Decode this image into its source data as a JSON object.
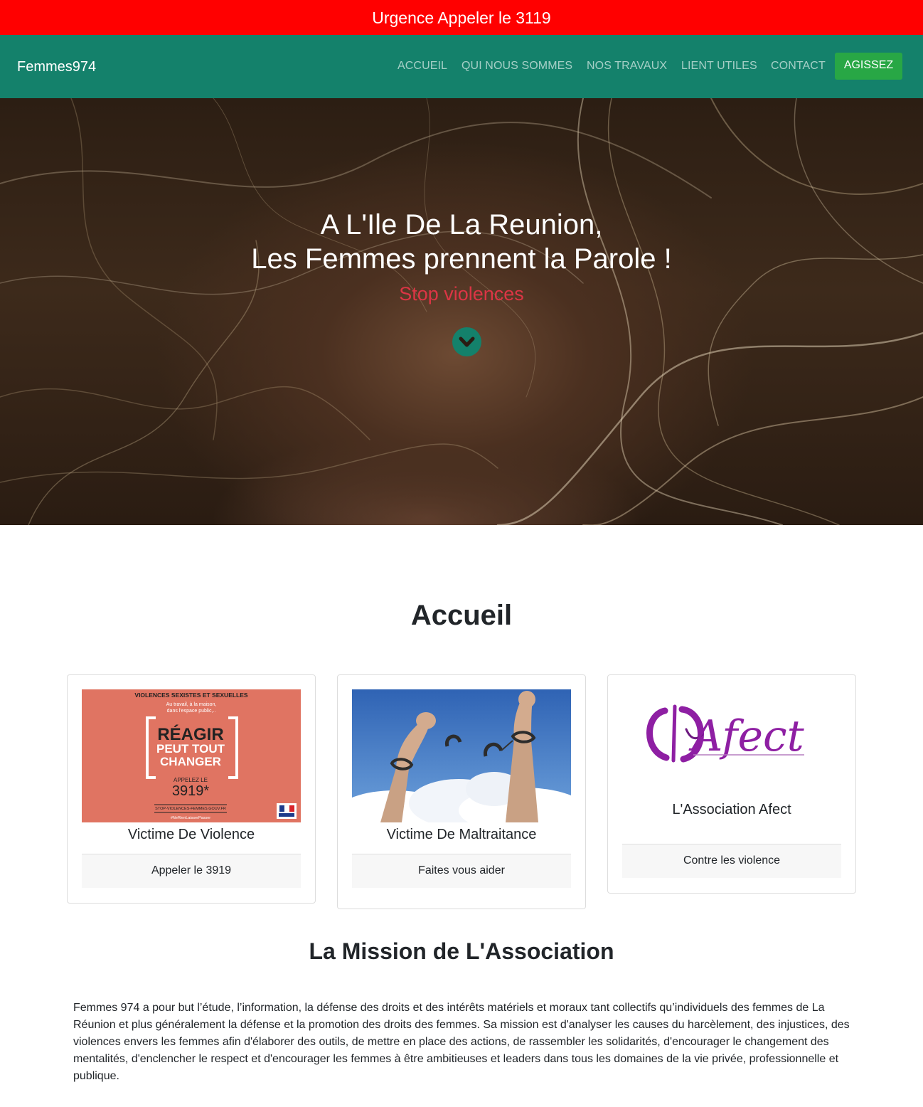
{
  "banner": {
    "text": "Urgence Appeler le 3119"
  },
  "navbar": {
    "brand": "Femmes974",
    "items": [
      "ACCUEIL",
      "QUI NOUS SOMMES",
      "NOS TRAVAUX",
      "LIENT UTILES",
      "CONTACT"
    ],
    "cta": "AGISSEZ"
  },
  "hero": {
    "line1": "A L'Ile De La Reunion,",
    "line2": "Les Femmes prennent la Parole !",
    "subtitle": "Stop violences",
    "scroll_icon": "chevron-down-circle-icon"
  },
  "section": {
    "title": "Accueil"
  },
  "cards": [
    {
      "title": "Victime De Violence",
      "footer": "Appeler le 3919",
      "poster": {
        "header": "VIOLENCES SEXISTES ET SEXUELLES",
        "line1": "Au travail, à la maison,",
        "line2": "dans l'espace public,..",
        "big1": "RÉAGIR",
        "big2": "PEUT TOUT",
        "big3": "CHANGER",
        "call": "APPELEZ LE",
        "number": "3919*",
        "url": "STOP-VIOLENCES-FEMMES.GOUV.FR",
        "hashtag": "#NeRienLaisserPasser"
      }
    },
    {
      "title": "Victime De Maltraitance",
      "footer": "Faites vous aider"
    },
    {
      "title": "L'Association Afect",
      "footer": "Contre les violence",
      "logo_text": "Afect"
    }
  ],
  "mission": {
    "title": "La Mission de L'Association",
    "text": "Femmes 974 a pour but l’étude, l’information, la défense des droits et des intérêts matériels et moraux tant collectifs qu’individuels des femmes de La Réunion et plus généralement la défense et la promotion des droits des femmes. Sa mission est d'analyser les causes du harcèlement, des injustices, des violences envers les femmes afin d'élaborer des outils, de mettre en place des actions, de rassembler les solidarités, d'encourager le changement des mentalités, d'enclencher le respect et d'encourager les femmes à être ambitieuses et leaders dans tous les domaines de la vie privée, professionnelle et publique."
  },
  "colors": {
    "banner": "#ff0000",
    "navbar": "#14816b",
    "cta": "#28a745",
    "accent_red": "#dc3545"
  }
}
